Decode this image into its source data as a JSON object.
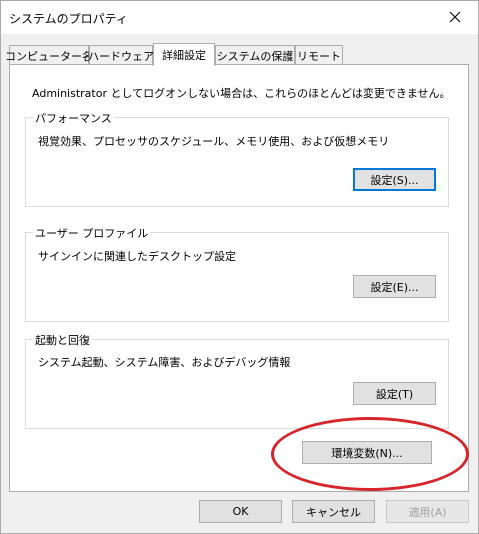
{
  "window": {
    "title": "システムのプロパティ"
  },
  "tabs": [
    {
      "label": "コンピューター名"
    },
    {
      "label": "ハードウェア"
    },
    {
      "label": "詳細設定"
    },
    {
      "label": "システムの保護"
    },
    {
      "label": "リモート"
    }
  ],
  "panel": {
    "notice": "Administrator としてログオンしない場合は、これらのほとんどは変更できません。",
    "performance": {
      "label": "パフォーマンス",
      "description": "視覚効果、プロセッサのスケジュール、メモリ使用、および仮想メモリ",
      "button": "設定(S)..."
    },
    "user_profile": {
      "label": "ユーザー プロファイル",
      "description": "サインインに関連したデスクトップ設定",
      "button": "設定(E)..."
    },
    "startup": {
      "label": "起動と回復",
      "description": "システム起動、システム障害、およびデバッグ情報",
      "button": "設定(T)"
    },
    "env_button": "環境変数(N)..."
  },
  "footer": {
    "ok": "OK",
    "cancel": "キャンセル",
    "apply": "適用(A)"
  },
  "colors": {
    "annotation": "#d6252b",
    "focus": "#0078d7"
  }
}
